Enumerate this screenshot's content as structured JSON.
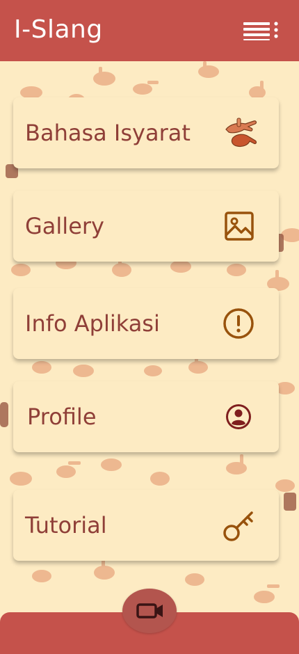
{
  "header": {
    "title": "I-Slang",
    "menu_icon": "hamburger-menu-icon"
  },
  "menu": {
    "items": [
      {
        "label": "Bahasa Isyarat",
        "icon": "sign-language-hands-icon"
      },
      {
        "label": "Gallery",
        "icon": "image-icon"
      },
      {
        "label": "Info Aplikasi",
        "icon": "alert-circle-icon"
      },
      {
        "label": "Profile",
        "icon": "user-circle-icon"
      },
      {
        "label": "Tutorial",
        "icon": "key-icon"
      }
    ]
  },
  "bottom": {
    "camera_icon": "video-camera-icon"
  },
  "colors": {
    "primary": "#c5524b",
    "background": "#fdebc3",
    "label": "#8f3f38",
    "icon": "#98520c"
  }
}
